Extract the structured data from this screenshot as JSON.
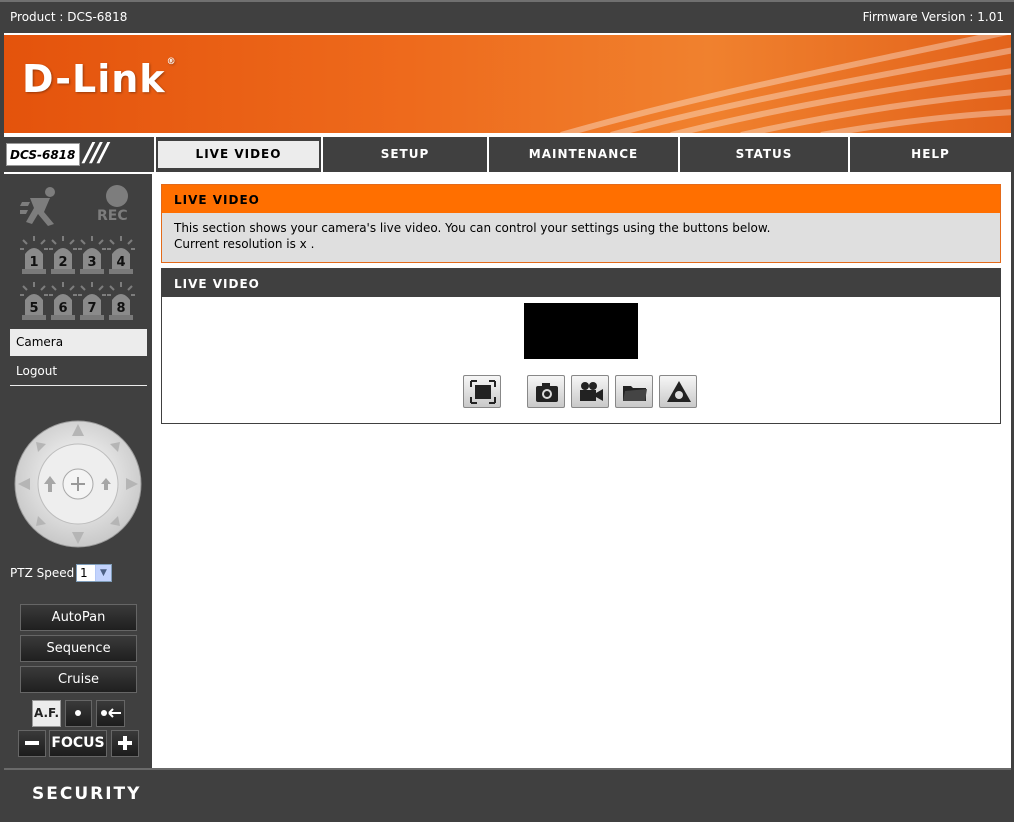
{
  "topbar": {
    "product": "Product : DCS-6818",
    "firmware": "Firmware Version : 1.01"
  },
  "banner": {
    "logo": "D-Link"
  },
  "nav": {
    "model": "DCS-6818",
    "tabs": [
      {
        "label": "LIVE VIDEO",
        "active": true
      },
      {
        "label": "SETUP"
      },
      {
        "label": "MAINTENANCE"
      },
      {
        "label": "STATUS"
      },
      {
        "label": "HELP"
      }
    ]
  },
  "sidebar": {
    "rec_label": "REC",
    "alarms": [
      "1",
      "2",
      "3",
      "4",
      "5",
      "6",
      "7",
      "8"
    ],
    "menu": [
      {
        "label": "Camera",
        "active": true
      },
      {
        "label": "Logout"
      }
    ],
    "ptz_speed_label": "PTZ Speed",
    "ptz_speed_value": "1",
    "buttons": [
      "AutoPan",
      "Sequence",
      "Cruise"
    ],
    "af_label": "A.F.",
    "focus_label": "FOCUS"
  },
  "main": {
    "sec1_title": "LIVE VIDEO",
    "sec1_line1": "This section shows your camera's live video. You can control your settings using the buttons below.",
    "sec1_line2": "Current resolution is  x .",
    "sec2_title": "LIVE VIDEO"
  },
  "footer": {
    "label": "SECURITY"
  },
  "colors": {
    "dark": "#404040",
    "accent": "#ff6f00",
    "panel": "#dfdfdf"
  }
}
